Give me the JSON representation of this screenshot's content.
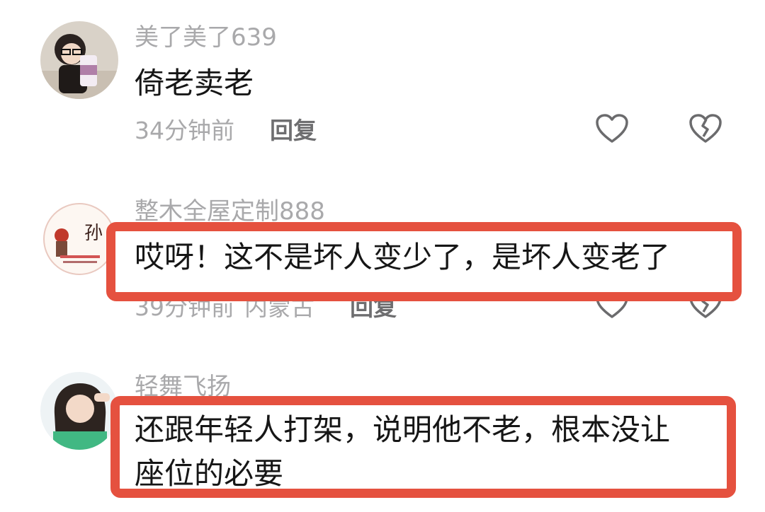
{
  "comments": [
    {
      "username": "美了美了639",
      "content": "倚老卖老",
      "time": "34分钟前",
      "reply": "回复"
    },
    {
      "username": "整木全屋定制888",
      "content": "哎呀！这不是坏人变少了，是坏人变老了",
      "time": "39分钟前",
      "location": "内蒙古",
      "reply": "回复"
    },
    {
      "username": "轻舞飞扬",
      "content_line1": "还跟年轻人打架，说明他不老，根本没让",
      "content_line2": "座位的必要"
    }
  ],
  "icons": [
    "heart-outline-icon",
    "broken-heart-icon"
  ],
  "colors": {
    "highlight": "#e5513f",
    "username": "#a9a9ab",
    "text": "#161616"
  }
}
